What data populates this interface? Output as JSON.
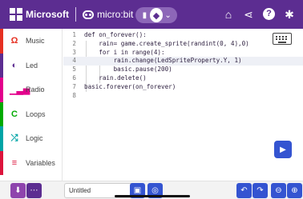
{
  "app": {
    "brand": "Microsoft",
    "product": "micro:bit"
  },
  "toggle": {
    "left_icon": "blocks-icon",
    "active_icon": "python-icon",
    "right_icon": "chevron-down-icon"
  },
  "header_icons": [
    "home-icon",
    "share-icon",
    "help-icon",
    "settings-icon"
  ],
  "sidebar": {
    "items": [
      {
        "label": "Music",
        "icon": "headphones-icon",
        "color": "#e63022"
      },
      {
        "label": "Led",
        "icon": "toggle-icon",
        "color": "#5c2d91"
      },
      {
        "label": "Radio",
        "icon": "signal-icon",
        "color": "#e3008c"
      },
      {
        "label": "Loops",
        "icon": "refresh-icon",
        "color": "#00aa00"
      },
      {
        "label": "Logic",
        "icon": "shuffle-icon",
        "color": "#00a4a6"
      },
      {
        "label": "Variables",
        "icon": "list-icon",
        "color": "#dc143c"
      }
    ]
  },
  "editor": {
    "lines": [
      {
        "num": "1",
        "text": "def on_forever():"
      },
      {
        "num": "2",
        "text": "    rain= game.create_sprite(randint(0, 4),0)"
      },
      {
        "num": "3",
        "text": "    for i in range(4):"
      },
      {
        "num": "4",
        "text": "        rain.change(LedSpriteProperty.Y, 1)"
      },
      {
        "num": "5",
        "text": "        basic.pause(200)"
      },
      {
        "num": "6",
        "text": "    rain.delete()"
      },
      {
        "num": "7",
        "text": "basic.forever(on_forever)"
      },
      {
        "num": "8",
        "text": ""
      }
    ],
    "active_line": 4
  },
  "bottom": {
    "project_name": "Untitled",
    "colors": {
      "download": "#8e44ad",
      "more": "#5c2d91",
      "save": "#3454d1",
      "github": "#3454d1",
      "undo": "#3454d1",
      "redo": "#3454d1",
      "zoom_out": "#3454d1",
      "zoom_in": "#3454d1"
    }
  }
}
